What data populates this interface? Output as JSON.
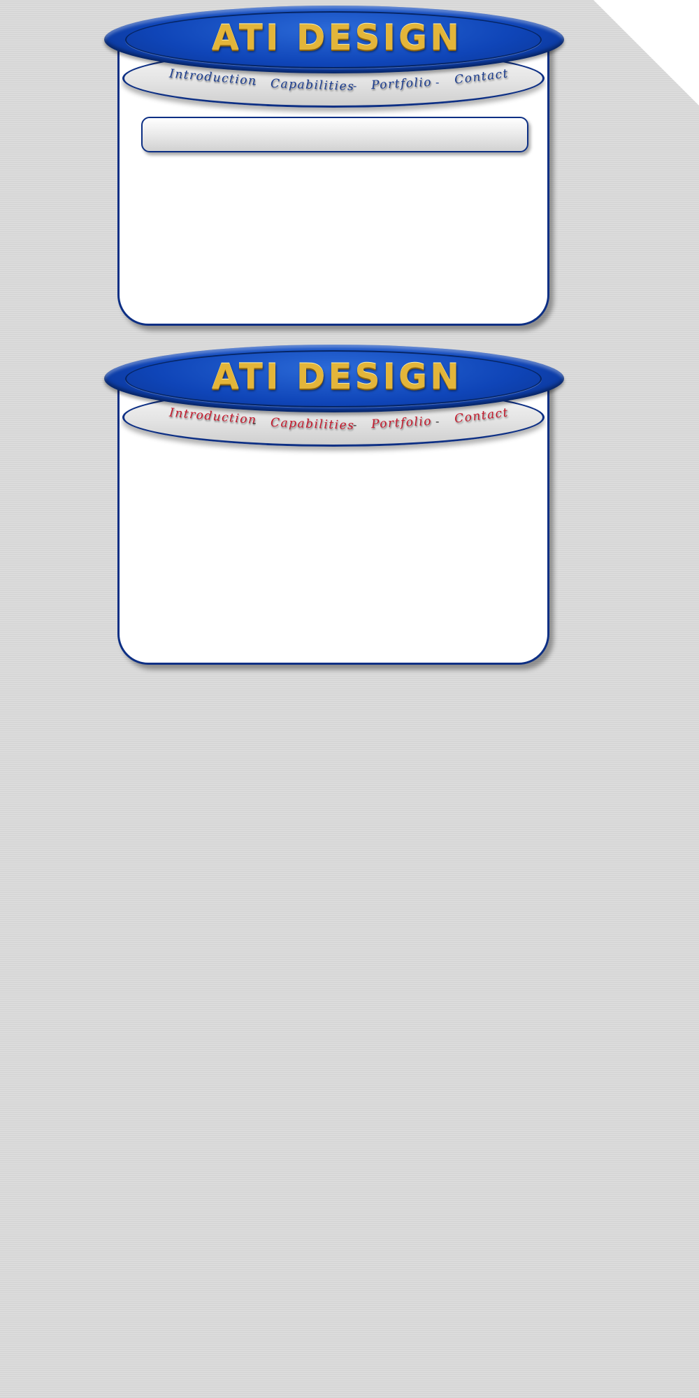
{
  "colors": {
    "background": "#d8d8d8",
    "brand_blue": "#0f45b8",
    "border_navy": "#0d2f84",
    "logo_gold": "#e3b53a",
    "nav_blue": "#1b3c8e",
    "nav_red": "#c4182b"
  },
  "mockups": [
    {
      "variant": "nav-blue",
      "logo": "ATI DESIGN",
      "nav": [
        "Introduction",
        "Capabilities",
        "Portfolio",
        "Contact"
      ],
      "separator": "-"
    },
    {
      "variant": "nav-red",
      "logo": "ATI DESIGN",
      "nav": [
        "Introduction",
        "Capabilities",
        "Portfolio",
        "Contact"
      ],
      "separator": "-"
    }
  ]
}
